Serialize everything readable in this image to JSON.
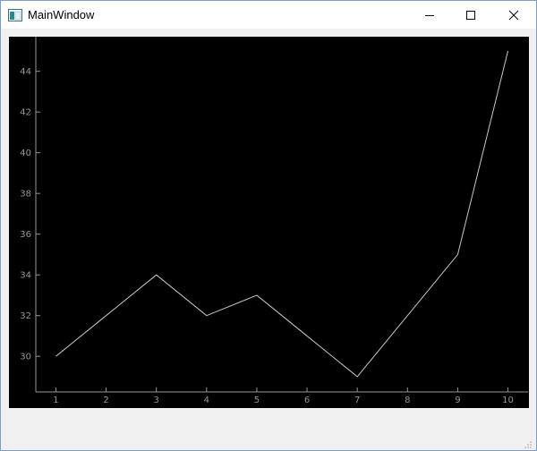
{
  "window": {
    "title": "MainWindow",
    "controls": [
      "minimize-icon",
      "maximize-icon",
      "close-icon"
    ]
  },
  "colors": {
    "plot_background": "#000000",
    "line": "#c8c8c8",
    "axis": "#969696",
    "window_background": "#f0f0f0"
  },
  "chart_data": {
    "type": "line",
    "x": [
      1,
      2,
      3,
      4,
      5,
      6,
      7,
      8,
      9,
      10
    ],
    "series": [
      {
        "values": [
          30,
          32,
          34,
          32,
          33,
          31,
          29,
          32,
          35,
          45
        ]
      }
    ],
    "xticks": [
      "1",
      "2",
      "3",
      "4",
      "5",
      "6",
      "7",
      "8",
      "9",
      "10"
    ],
    "yticks": [
      "30",
      "32",
      "34",
      "36",
      "38",
      "40",
      "42",
      "44"
    ],
    "xlim": [
      0.6,
      10.4
    ],
    "ylim": [
      28.25,
      45.7
    ],
    "grid": false
  }
}
